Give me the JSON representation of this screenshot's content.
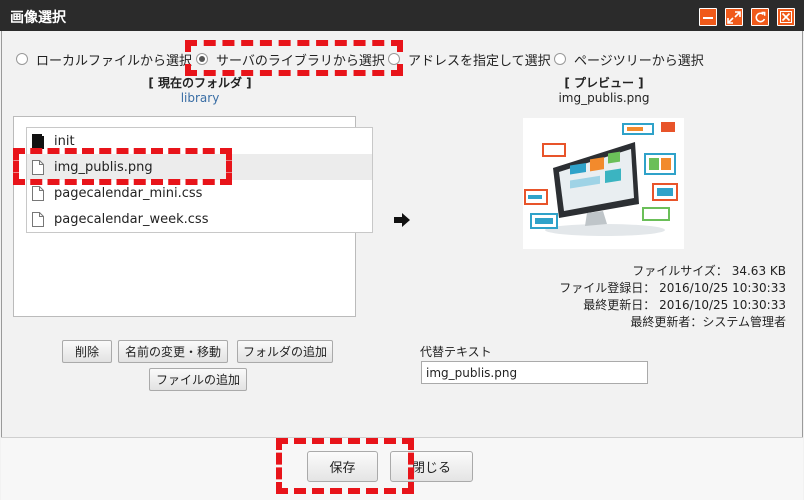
{
  "window": {
    "title": "画像選択",
    "controls": [
      "minimize-icon",
      "maximize-icon",
      "refresh-icon",
      "close-icon"
    ],
    "control_color": "#f05a1a"
  },
  "source_options": [
    {
      "label": "ローカルファイルから選択",
      "selected": false
    },
    {
      "label": "サーバのライブラリから選択",
      "selected": true
    },
    {
      "label": "アドレスを指定して選択",
      "selected": false
    },
    {
      "label": "ページツリーから選択",
      "selected": false
    }
  ],
  "folder": {
    "heading": "[ 現在のフォルダ ]",
    "path": "library"
  },
  "files": [
    {
      "name": "init",
      "type": "folder",
      "selected": false
    },
    {
      "name": "img_publis.png",
      "type": "file",
      "selected": true
    },
    {
      "name": "pagecalendar_mini.css",
      "type": "file",
      "selected": false
    },
    {
      "name": "pagecalendar_week.css",
      "type": "file",
      "selected": false
    }
  ],
  "file_actions": {
    "delete": "削除",
    "rename": "名前の変更・移動",
    "add_folder": "フォルダの追加",
    "add_file": "ファイルの追加"
  },
  "preview": {
    "heading": "[ プレビュー ]",
    "filename": "img_publis.png",
    "file_size": "ファイルサイズ： 34.63 KB",
    "registered": "ファイル登録日： 2016/10/25 10:30:33",
    "updated": "最終更新日： 2016/10/25 10:30:33",
    "updated_by": "最終更新者：システム管理者"
  },
  "alt_text": {
    "label": "代替テキスト",
    "value": "img_publis.png"
  },
  "footer": {
    "save": "保存",
    "close": "閉じる"
  },
  "highlight_color": "#e8141a"
}
